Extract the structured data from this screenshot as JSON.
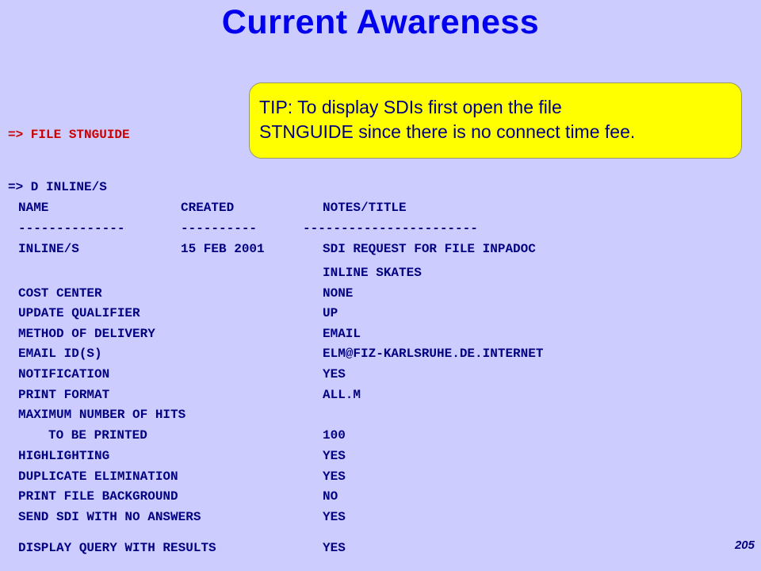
{
  "title": "Current Awareness",
  "tip": {
    "line1": "TIP: To display SDIs first open the file",
    "line2": "STNGUIDE since there is no connect time fee."
  },
  "commands": {
    "file": "=> FILE STNGUIDE",
    "display": "=> D INLINE/S"
  },
  "table": {
    "headers": {
      "name": "NAME",
      "created": "CREATED",
      "notes": "NOTES/TITLE"
    },
    "separators": {
      "name": "--------------",
      "created": "----------",
      "notes": "-----------------------"
    },
    "row": {
      "name": "INLINE/S",
      "created": "15 FEB 2001",
      "notes": "SDI REQUEST FOR FILE INPADOC",
      "notes2": "INLINE SKATES"
    }
  },
  "settings": [
    {
      "label": "COST CENTER",
      "value": "NONE"
    },
    {
      "label": "UPDATE QUALIFIER",
      "value": "UP"
    },
    {
      "label": "METHOD OF DELIVERY",
      "value": "EMAIL"
    },
    {
      "label": "EMAIL ID(S)",
      "value": "ELM@FIZ-KARLSRUHE.DE.INTERNET"
    },
    {
      "label": "NOTIFICATION",
      "value": "YES"
    },
    {
      "label": "PRINT FORMAT",
      "value": "ALL.M"
    },
    {
      "label": "MAXIMUM NUMBER OF HITS",
      "value": ""
    },
    {
      "label": "TO BE PRINTED",
      "value": "100"
    },
    {
      "label": "HIGHLIGHTING",
      "value": "YES"
    },
    {
      "label": "DUPLICATE ELIMINATION",
      "value": "YES"
    },
    {
      "label": "PRINT FILE BACKGROUND",
      "value": "NO"
    },
    {
      "label": "SEND SDI WITH NO ANSWERS",
      "value": "YES"
    },
    {
      "label": "DISPLAY QUERY WITH RESULTS",
      "value": "YES"
    }
  ],
  "page_number": "205",
  "colors": {
    "background": "#ccccff",
    "title": "#0000ee",
    "text": "#000080",
    "command": "#cc0000",
    "tip": "#ffff00"
  }
}
